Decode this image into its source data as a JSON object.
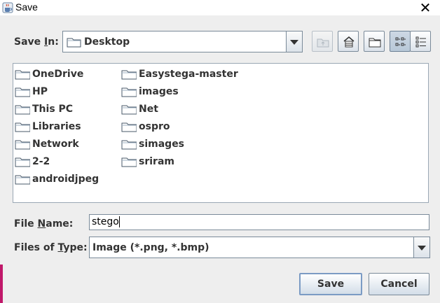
{
  "window": {
    "title": "Save",
    "app_icon": "java-cup-icon",
    "close_glyph": "✕"
  },
  "save_in": {
    "label_pre": "Save ",
    "label_mnemonic": "I",
    "label_post": "n:",
    "value": "Desktop"
  },
  "toolbar": {
    "buttons": [
      "up-one-level",
      "home",
      "create-new-folder",
      "list-view",
      "details-view"
    ]
  },
  "files": {
    "column1": [
      "OneDrive",
      "HP",
      "This PC",
      "Libraries",
      "Network",
      "2-2",
      "androidjpeg"
    ],
    "column2": [
      "Easystega-master",
      "images",
      "Net",
      "ospro",
      "simages",
      "sriram"
    ]
  },
  "file_name": {
    "label_pre": "File ",
    "label_mnemonic": "N",
    "label_post": "ame:",
    "value": "stego"
  },
  "file_type": {
    "label_pre": "Files of ",
    "label_mnemonic": "T",
    "label_post": "ype:",
    "value": "Image (*.png, *.bmp)"
  },
  "buttons": {
    "save": "Save",
    "cancel": "Cancel"
  },
  "colors": {
    "background": "#eeeeee",
    "border": "#7a8a99",
    "default_button_ring": "#7b9bc4",
    "accent_strip": "#c0186a"
  }
}
